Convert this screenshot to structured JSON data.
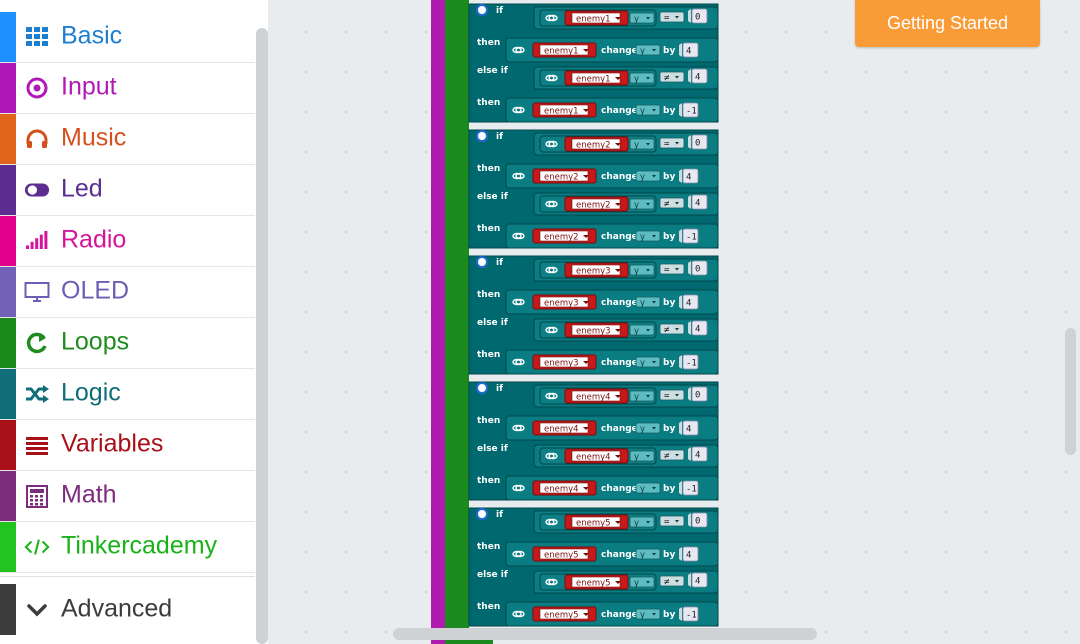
{
  "toolbox": {
    "categories": [
      {
        "key": "basic",
        "label": "Basic",
        "color": "#1e90ff",
        "icon": "grid-icon"
      },
      {
        "key": "input",
        "label": "Input",
        "color": "#d400d4",
        "icon": "radio-target-icon"
      },
      {
        "key": "music",
        "label": "Music",
        "color": "#e63022",
        "icon": "headphones-icon"
      },
      {
        "key": "led",
        "label": "Led",
        "color": "#5c2d91",
        "icon": "toggle-icon"
      },
      {
        "key": "radio",
        "label": "Radio",
        "color": "#e3008c",
        "icon": "signal-bars-icon"
      },
      {
        "key": "oled",
        "label": "OLED",
        "color": "#7160b8",
        "icon": "monitor-icon"
      },
      {
        "key": "loops",
        "label": "Loops",
        "color": "#00aa00",
        "icon": "refresh-icon"
      },
      {
        "key": "logic",
        "label": "Logic",
        "color": "#00a4a6",
        "icon": "shuffle-icon"
      },
      {
        "key": "variables",
        "label": "Variables",
        "color": "#dc143c",
        "icon": "list-lines-icon"
      },
      {
        "key": "math",
        "label": "Math",
        "color": "#9400d3",
        "icon": "calculator-icon"
      },
      {
        "key": "tinkercademy",
        "label": "Tinkercademy",
        "color": "#28c821",
        "icon": "code-icon"
      }
    ],
    "advanced": {
      "label": "Advanced",
      "icon": "chevron-down-icon"
    }
  },
  "getting_started": "Getting Started",
  "blocks": {
    "keyword_if": "if",
    "keyword_then": "then",
    "keyword_else_if": "else if",
    "keyword_change": "change",
    "keyword_by": "by",
    "property": "y",
    "op_eq": "=",
    "op_neq": "≠",
    "compare_zero": "0",
    "compare_four": "4",
    "delta_pos": "4",
    "delta_neg": "-1",
    "sprites": [
      "enemy1",
      "enemy2",
      "enemy3",
      "enemy4",
      "enemy5"
    ]
  }
}
